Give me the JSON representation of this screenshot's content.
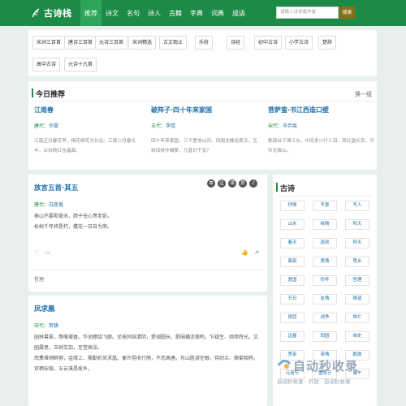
{
  "header": {
    "logo_text": "古诗栈",
    "nav": [
      "推荐",
      "诗文",
      "名句",
      "诗人",
      "古籍",
      "字典",
      "词典",
      "成语"
    ],
    "search_placeholder": "请输入诗词或作者",
    "search_button": "搜索"
  },
  "tags": [
    "宋词三百首",
    "唐诗三百首",
    "元诗三百首",
    "宋词精选",
    "古文观止",
    "乐府",
    "诗经",
    "初中古诗",
    "小学古诗",
    "楚辞",
    "高中古诗",
    "元诗十九首"
  ],
  "recommend": {
    "title": "今日推荐",
    "more": "换一组",
    "items": [
      {
        "title": "江南春",
        "dynasty": "唐代：",
        "author": "许棠",
        "excerpt": "江南正月春花早，梅花柳花次长远。江南二月春光半，古白桃红含晶霖。"
      },
      {
        "title": "破阵子·四十年来家国",
        "dynasty": "五代：",
        "author": "李煜",
        "excerpt": "四十年来家国，三千里地山河。凤阁龙楼连霄汉，玉树琼枝作烟萝，几曾识干戈？"
      },
      {
        "title": "菩萨蛮·书江西造口壁",
        "dynasty": "宋代：",
        "author": "辛弃疾",
        "excerpt": "郁孤台下清江水，中间多少行人泪。西北望长安，可怜无数山。"
      }
    ]
  },
  "poems": [
    {
      "title": "放言五首·其五",
      "dynasty": "唐代：",
      "author": "白居易",
      "lines": [
        "泰山不要欺毫末，颜子无心羡老彭。",
        "松树千年终是朽，槿花一日自为荣。"
      ],
      "tag": "哲理"
    },
    {
      "title": "凤求凰",
      "dynasty": "宋代：",
      "author": "贺铸",
      "lines": [
        "园林幕翠，燕嗓凝香。华池缭绕飞廊。坐按同结清阴，楚调圆长。歌阑横流美眄，乍疑生、绮席辉光。文园属意，玉树交加，至堂高张。",
        "南薰难销醉侧，金缕上，殷勤彩凤求凰。便许卷收行雨，不恋高唐。东山胜游在眼，待纫兰、撷菊相将。双栖安稳，五云溪是故乡。"
      ]
    }
  ],
  "sidebar": {
    "title": "古诗",
    "cells": [
      "抒情",
      "写景",
      "写人",
      "山水",
      "咏物",
      "秋天",
      "春天",
      "送别",
      "秋天",
      "离别",
      "爱情",
      "思乡",
      "爱国",
      "伤怀",
      "哲理",
      "节日",
      "友情",
      "情谊",
      "闺怨",
      "战争",
      "悼亡",
      "边塞",
      "田园",
      "咏史",
      "思亲",
      "亲情",
      "羁旅",
      "元宵节",
      "重阳节",
      "端午"
    ]
  },
  "watermark": {
    "big": "自动秒收录",
    "small": "自动秒收录 · 开放 · 自动秒收录"
  }
}
